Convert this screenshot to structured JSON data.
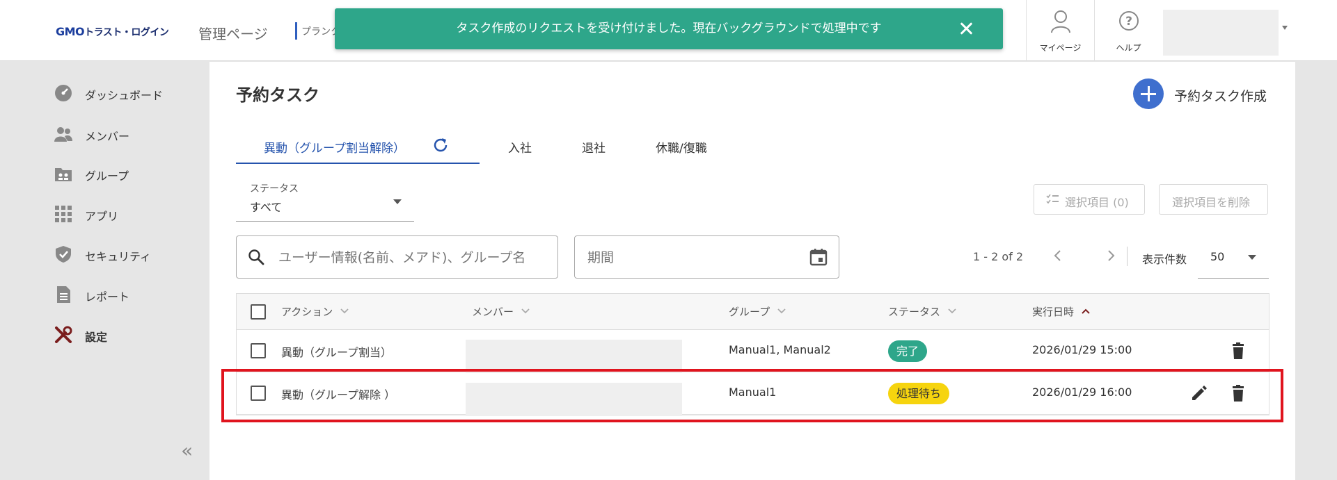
{
  "header": {
    "logo_gmo": "GMO",
    "logo_rest": "トラスト・ログイン",
    "admin_label": "管理ページ",
    "plan_label": "プランク",
    "mypage_label": "マイページ",
    "help_label": "ヘルプ"
  },
  "toast": {
    "message": "タスク作成のリクエストを受け付けました。現在バックグラウンドで処理中です",
    "color": "#2ea68a"
  },
  "sidebar": {
    "items": [
      {
        "label": "ダッシュボード",
        "icon": "dashboard-icon"
      },
      {
        "label": "メンバー",
        "icon": "members-icon"
      },
      {
        "label": "グループ",
        "icon": "group-icon"
      },
      {
        "label": "アプリ",
        "icon": "apps-icon"
      },
      {
        "label": "セキュリティ",
        "icon": "shield-icon"
      },
      {
        "label": "レポート",
        "icon": "report-icon"
      },
      {
        "label": "設定",
        "icon": "tools-icon",
        "active": true
      }
    ],
    "collapse_label": "«"
  },
  "main": {
    "title": "予約タスク",
    "create_label": "予約タスク作成",
    "tabs": [
      {
        "label": "異動（グループ割当解除）",
        "active": true
      },
      {
        "label": "入社"
      },
      {
        "label": "退社"
      },
      {
        "label": "休職/復職"
      }
    ],
    "status_filter": {
      "label": "ステータス",
      "value": "すべて"
    },
    "selected_button": "選択項目 (0)",
    "delete_selected_button": "選択項目を削除",
    "search_placeholder": "ユーザー情報(名前、メアド)、グループ名",
    "period_placeholder": "期間",
    "pager": {
      "range": "1 - 2 of 2",
      "per_page_label": "表示件数",
      "per_page_value": "50"
    }
  },
  "table": {
    "columns": [
      "アクション",
      "メンバー",
      "グループ",
      "ステータス",
      "実行日時"
    ],
    "rows": [
      {
        "action": "異動（グループ割当）",
        "member": "",
        "group": "Manual1, Manual2",
        "status": "完了",
        "status_type": "done",
        "datetime": "2026/01/29 15:00",
        "editable": false
      },
      {
        "action": "異動（グループ解除 ）",
        "member": "",
        "group": "Manual1",
        "status": "処理待ち",
        "status_type": "pending",
        "datetime": "2026/01/29 16:00",
        "editable": true
      }
    ]
  },
  "colors": {
    "accent": "#2654ad",
    "success": "#2ea68a",
    "pending": "#f6d40e",
    "highlight": "#e0141e"
  }
}
